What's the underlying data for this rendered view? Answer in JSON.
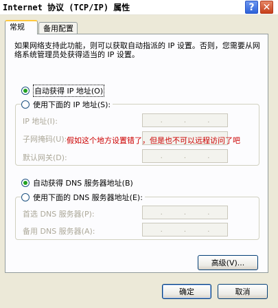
{
  "window": {
    "title": "Internet 协议 (TCP/IP) 属性",
    "help_label": "?",
    "close_label": "✕"
  },
  "tabs": [
    {
      "label": "常规"
    },
    {
      "label": "备用配置"
    }
  ],
  "description": "如果网络支持此功能，则可以获取自动指派的 IP 设置。否则，您需要从网络系统管理员处获得适当的 IP 设置。",
  "ip_section": {
    "auto_label": "自动获得 IP 地址(O)",
    "manual_label": "使用下面的 IP 地址(S):",
    "auto_checked": true,
    "fields": [
      {
        "label": "IP 地址(I):"
      },
      {
        "label": "子网掩码(U):"
      },
      {
        "label": "默认网关(D):"
      }
    ]
  },
  "annotation": "假如这个地方设置错了，但是也不可以远程访问了吧",
  "dns_section": {
    "auto_label": "自动获得 DNS 服务器地址(B)",
    "manual_label": "使用下面的 DNS 服务器地址(E):",
    "auto_checked": true,
    "fields": [
      {
        "label": "首选 DNS 服务器(P):"
      },
      {
        "label": "备用 DNS 服务器(A):"
      }
    ]
  },
  "buttons": {
    "advanced": "高级(V)...",
    "ok": "确定",
    "cancel": "取消"
  },
  "ip_dots": "."
}
